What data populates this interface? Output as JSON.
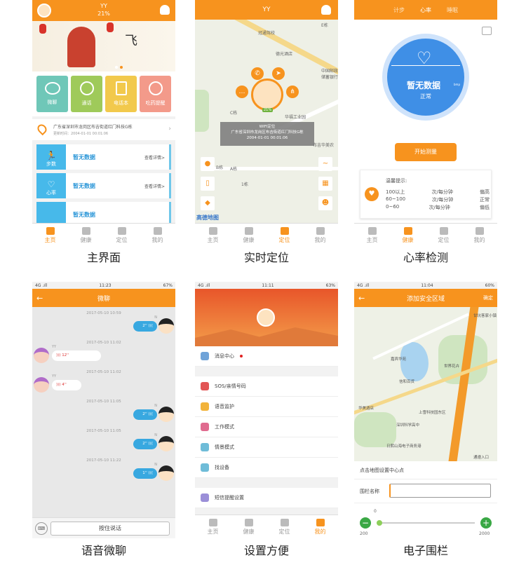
{
  "captions": [
    "主界面",
    "实时定位",
    "心率检测",
    "语音微聊",
    "设置方便",
    "电子围栏"
  ],
  "tabs": [
    "主页",
    "健康",
    "定位",
    "我的"
  ],
  "home": {
    "header_title": "YY",
    "battery": "21%",
    "tiles": [
      "微聊",
      "通话",
      "电话本",
      "吃药提醒"
    ],
    "address": "广东省深圳市龙岗区布吉街道红门科技G栋",
    "update_time": "更新时间：2004-01-01 00:01:06",
    "cards": [
      {
        "icon_label": "步数",
        "value": "暂无数据",
        "link": "查看详情>"
      },
      {
        "icon_label": "心率",
        "value": "暂无数据",
        "link": "查看详情>"
      },
      {
        "icon_label": "",
        "value": "暂无数据",
        "link": ""
      }
    ]
  },
  "location": {
    "title": "YY",
    "map_labels": [
      "冠通驾校",
      "德光酒店",
      "中国邮政储蓄银行",
      "华福工业园",
      "C栋",
      "B栋",
      "A栋",
      "1栋",
      "E栋",
      "布吉华美农"
    ],
    "popup_line1": "WIFI定位",
    "popup_line2": "广东省深圳市龙岗区布吉街道红门科技G栋",
    "popup_line3": "2004-01-01 00:01:06",
    "badge": "21%",
    "map_provider": "高德地图"
  },
  "heart": {
    "tabs": [
      "计步",
      "心率",
      "睡眠"
    ],
    "value": "暂无数据",
    "unit": "bmp",
    "status": "正常",
    "button": "开始测量",
    "tips_title": "温馨提示:",
    "tips": [
      [
        "100以上",
        "次/每分钟",
        "偏高"
      ],
      [
        "60~100",
        "次/每分钟",
        "正常"
      ],
      [
        "0~60",
        "次/每分钟",
        "偏低"
      ]
    ]
  },
  "chat": {
    "status_left": "4G .ıll",
    "time": "11:23",
    "battery": "67%",
    "title": "微聊",
    "messages": [
      {
        "ts": "2017-05-10 10:59",
        "side": "right",
        "dur": "2''",
        "name": "N"
      },
      {
        "ts": "2017-05-10 11:02",
        "side": "left",
        "dur": "12''",
        "name": "YY"
      },
      {
        "ts": "2017-05-10 11:02",
        "side": "left",
        "dur": "4''",
        "name": "YY"
      },
      {
        "ts": "2017-05-10 11:05",
        "side": "right",
        "dur": "2''",
        "name": "N"
      },
      {
        "ts": "2017-05-10 11:05",
        "side": "right",
        "dur": "2''",
        "name": "N"
      },
      {
        "ts": "2017-05-10 11:22",
        "side": "right",
        "dur": "1''",
        "name": "N"
      }
    ],
    "hold_to_talk": "按住说话"
  },
  "settings": {
    "time": "11:11",
    "battery": "63%",
    "items": [
      "消息中心",
      "SOS/亲情号码",
      "语音监护",
      "工作模式",
      "情景模式",
      "找设备",
      "短信提醒设置"
    ]
  },
  "fence": {
    "time": "11:04",
    "battery": "60%",
    "title": "添加安全区域",
    "confirm": "确定",
    "map_labels": [
      "嘉宾华苑",
      "甘坑客家小镇",
      "世界花卉",
      "信和百货",
      "上雪科技园东区",
      "深圳科学高中",
      "日熙山海电子商务港",
      "华美酒店",
      "通遵入口"
    ],
    "hint": "点击地图设置中心点",
    "field_label": "围栏名称",
    "min": "200",
    "max": "2000",
    "current": "0",
    "slider_value": 0
  },
  "colors": {
    "accent": "#f7931e",
    "heart_blue": "#3f8fe6"
  }
}
